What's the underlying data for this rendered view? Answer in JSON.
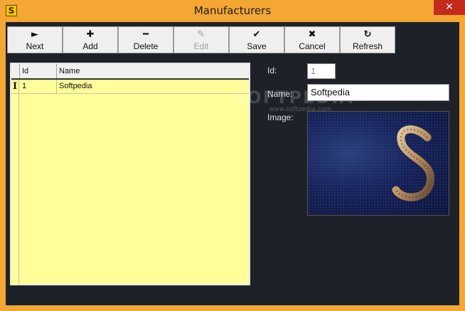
{
  "window": {
    "title": "Manufacturers",
    "app_icon_letter": "S",
    "close_glyph": "✕"
  },
  "toolbar": {
    "buttons": [
      {
        "label": "Next",
        "icon": "next-arrow-icon",
        "glyph": "►",
        "enabled": true
      },
      {
        "label": "Add",
        "icon": "plus-icon",
        "glyph": "✚",
        "enabled": true
      },
      {
        "label": "Delete",
        "icon": "minus-icon",
        "glyph": "━",
        "enabled": true
      },
      {
        "label": "Edit",
        "icon": "pencil-icon",
        "glyph": "✎",
        "enabled": false
      },
      {
        "label": "Save",
        "icon": "checkmark-icon",
        "glyph": "✔",
        "enabled": true
      },
      {
        "label": "Cancel",
        "icon": "x-icon",
        "glyph": "✖",
        "enabled": true
      },
      {
        "label": "Refresh",
        "icon": "refresh-icon",
        "glyph": "↻",
        "enabled": true
      }
    ]
  },
  "grid": {
    "columns": [
      "Id",
      "Name"
    ],
    "rows": [
      {
        "id": "1",
        "name": "Softpedia"
      }
    ],
    "current_row_marker": "I",
    "background": "#ffff99"
  },
  "form": {
    "id_label": "Id:",
    "id_value": "1",
    "name_label": "Name:",
    "name_value": "Softpedia",
    "image_label": "Image:"
  },
  "watermark": {
    "text": "SOFTPEDIA",
    "url": "www.softpedia.com"
  },
  "colors": {
    "titlebar": "#f4a732",
    "client_bg": "#1c2228",
    "close_button": "#c42b1c"
  }
}
